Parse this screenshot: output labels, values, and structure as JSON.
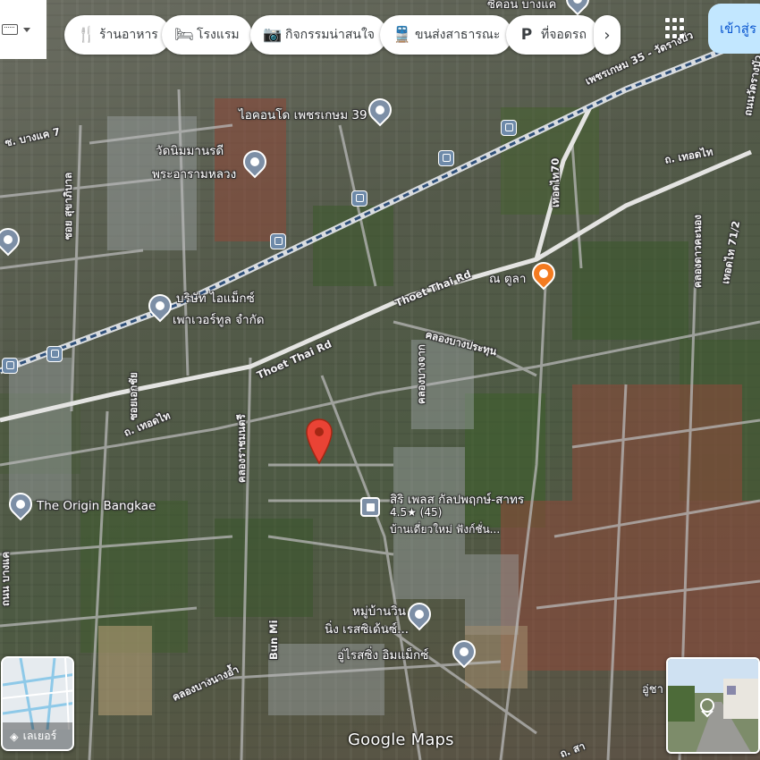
{
  "toolbar": {
    "chips": [
      {
        "icon": "restaurant-icon",
        "label": "ร้านอาหาร"
      },
      {
        "icon": "hotel-icon",
        "label": "โรงแรม"
      },
      {
        "icon": "camera-icon",
        "label": "กิจกรรมน่าสนใจ"
      },
      {
        "icon": "bus-icon",
        "label": "ขนส่งสาธารณะ"
      },
      {
        "icon": "parking-icon",
        "label": "ที่จอดรถ"
      }
    ],
    "more_label": "›",
    "signin_label": "เข้าสู่ร"
  },
  "map": {
    "places": {
      "icondo": "ไอคอนโด เพชรเกษม 39",
      "temple_line1": "วัดนิมมานรดี",
      "temple_line2": "พระอารามหลวง",
      "company_line1": "บริษัท ไอแม็กซ์",
      "company_line2": "เพาเวอร์ทูล จำกัด",
      "origin": "The Origin Bangkae",
      "siri_line1": "สิริ เพลส กัลปพฤกษ์-สาทร",
      "siri_rating": "4.5★ (45)",
      "siri_line3": "บ้านเดี่ยวใหม่ ฟังก์ชั่น...",
      "win_line1": "หมู่บ้านวิน",
      "win_line2": "นิ่ง เรสซิเด้นซ์...",
      "ulai": "อู่ไรสซิ่ง อิมแม็กซ์",
      "nutala": "ณ ตูลา",
      "top_cut": "ซีคอน บางแค",
      "bottom_right_cut": "อู่ชา"
    },
    "roads": {
      "phetkasem": "เพชรเกษม 35 - วัดรางบัว",
      "thoet_thai_1": "Thoet Thai Rd",
      "thoet_thai_2": "Thoet Thai Rd",
      "soi_bangkhae7": "ซ. บางแค 7",
      "soi_left1": "ซอย สุขาภิบาล",
      "thoet_thai_th": "ถ. เทอดไท",
      "thoet_thai_th2": "ถ. เทอดไท",
      "soi_thoetthai70": "เทอดไท70",
      "khlong_dao_kanong": "คลองดาวคะนอง",
      "thoet_thai_71": "เทอดไท 71/2",
      "khlong_bang_prathun": "คลองบางประทุน",
      "khlong_bang_chuak": "คลองบางจาก",
      "khlong_rachamontri": "คลองราชมนตรี",
      "soi_charan": "ซอยเอกชัย",
      "bun_mi": "Bun Mi",
      "khlong_bang_nang_am": "คลองบางนางอ้ำ",
      "wat_rang_right": "ถนนวัดรางบัว",
      "left_vertical": "ถนน บางแค",
      "bottom_right_rd": "ถ. สา"
    }
  },
  "layers": {
    "label": "เลเยอร์"
  },
  "attribution": "Google Maps",
  "colors": {
    "red_pin": "#ea4335",
    "poi_gray": "#7d8fa6",
    "food_orange": "#f47b20",
    "signin_bg": "#c2e7ff"
  }
}
